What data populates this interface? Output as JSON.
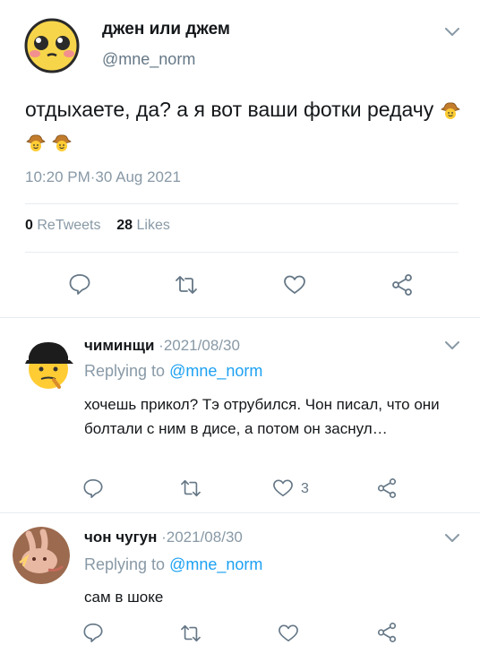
{
  "main_tweet": {
    "name": "джен или джем",
    "handle": "@mne_norm",
    "text": "отдыхаете, да? а я вот ваши фотки редачу",
    "timestamp": "10:20 PM·30 Aug 2021",
    "retweets_count": "0",
    "retweets_label": "ReTweets",
    "likes_count": "28",
    "likes_label": "Likes"
  },
  "replies": [
    {
      "name": "чиминщи",
      "date": "·2021/08/30",
      "replying_prefix": "Replying to",
      "replying_handle": "@mne_norm",
      "text": "хочешь прикол? Тэ отрубился. Чон писал, что они болтали с ним в дисе, а потом он заснул…",
      "like_count": "3"
    },
    {
      "name": "чон чугун",
      "date": "·2021/08/30",
      "replying_prefix": "Replying to",
      "replying_handle": "@mne_norm",
      "text": "сам в шоке",
      "like_count": ""
    }
  ],
  "colors": {
    "accent": "#1da1f2",
    "muted": "#8899a6",
    "text": "#14171a",
    "separator": "#e6ecf0"
  },
  "icons": [
    "reply-icon",
    "retweet-icon",
    "like-icon",
    "share-icon",
    "chevron-down-icon",
    "cowboy-emoji"
  ]
}
